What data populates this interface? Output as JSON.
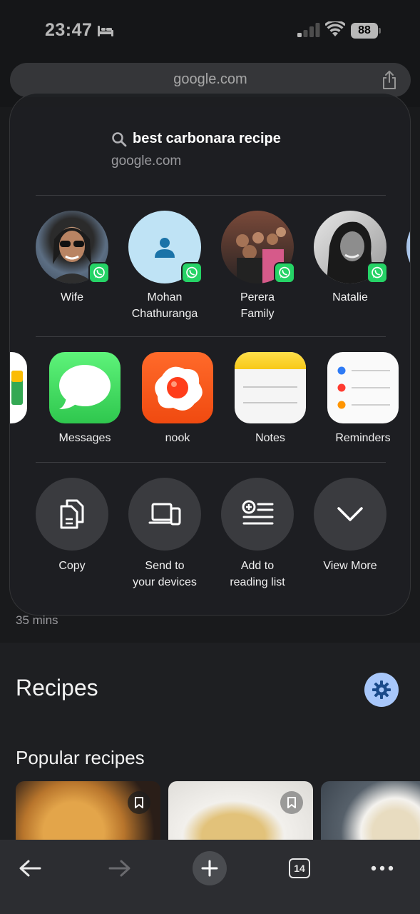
{
  "status_bar": {
    "time": "23:47",
    "battery": "88"
  },
  "address_bar": {
    "url": "google.com"
  },
  "share_sheet": {
    "query": "best carbonara recipe",
    "domain": "google.com",
    "contacts": [
      {
        "name": "Wife",
        "badge": "whatsapp-icon"
      },
      {
        "name_line1": "Mohan",
        "name_line2": "Chathuranga",
        "badge": "whatsapp-icon"
      },
      {
        "name_line1": "Perera",
        "name_line2": "Family",
        "badge": "whatsapp-icon"
      },
      {
        "name": "Natalie",
        "badge": "whatsapp-icon"
      }
    ],
    "apps": [
      {
        "label": "Messages",
        "icon": "messages-icon"
      },
      {
        "label": "nook",
        "icon": "nook-icon"
      },
      {
        "label": "Notes",
        "icon": "notes-icon"
      },
      {
        "label": "Reminders",
        "icon": "reminders-icon"
      }
    ],
    "actions": [
      {
        "line1": "Copy",
        "line2": "",
        "icon": "copy-icon"
      },
      {
        "line1": "Send to",
        "line2": "your devices",
        "icon": "devices-icon"
      },
      {
        "line1": "Add to",
        "line2": "reading list",
        "icon": "reading-list-icon"
      },
      {
        "line1": "View More",
        "line2": "",
        "icon": "chevron-down-icon"
      }
    ]
  },
  "page": {
    "duration": "35 mins",
    "recipes_heading": "Recipes",
    "popular_heading": "Popular recipes"
  },
  "toolbar": {
    "tab_count": "14"
  },
  "colors": {
    "whatsapp": "#25d366",
    "gear_button": "#a8c7fa",
    "messages_green": "#34c759",
    "nook_orange": "#ff5a1f",
    "notes_yellow": "#ffd52e"
  }
}
